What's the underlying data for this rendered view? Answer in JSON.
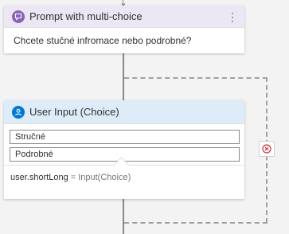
{
  "prompt_card": {
    "title": "Prompt with multi-choice",
    "question": "Chcete stučné infromace nebo podrobné?",
    "menu_glyph": "⋮",
    "accent_color": "#8764b8",
    "icon": "chat-bubble-icon"
  },
  "input_card": {
    "title": "User Input (Choice)",
    "accent_color": "#0078d4",
    "icon": "user-icon",
    "choices": [
      "Stručné",
      "Podrobné"
    ],
    "assignment": {
      "property": "user.shortLong",
      "operator": "=",
      "value": "Input(Choice)"
    }
  },
  "error_badge": {
    "icon": "error-circle-icon",
    "color": "#d13438"
  }
}
